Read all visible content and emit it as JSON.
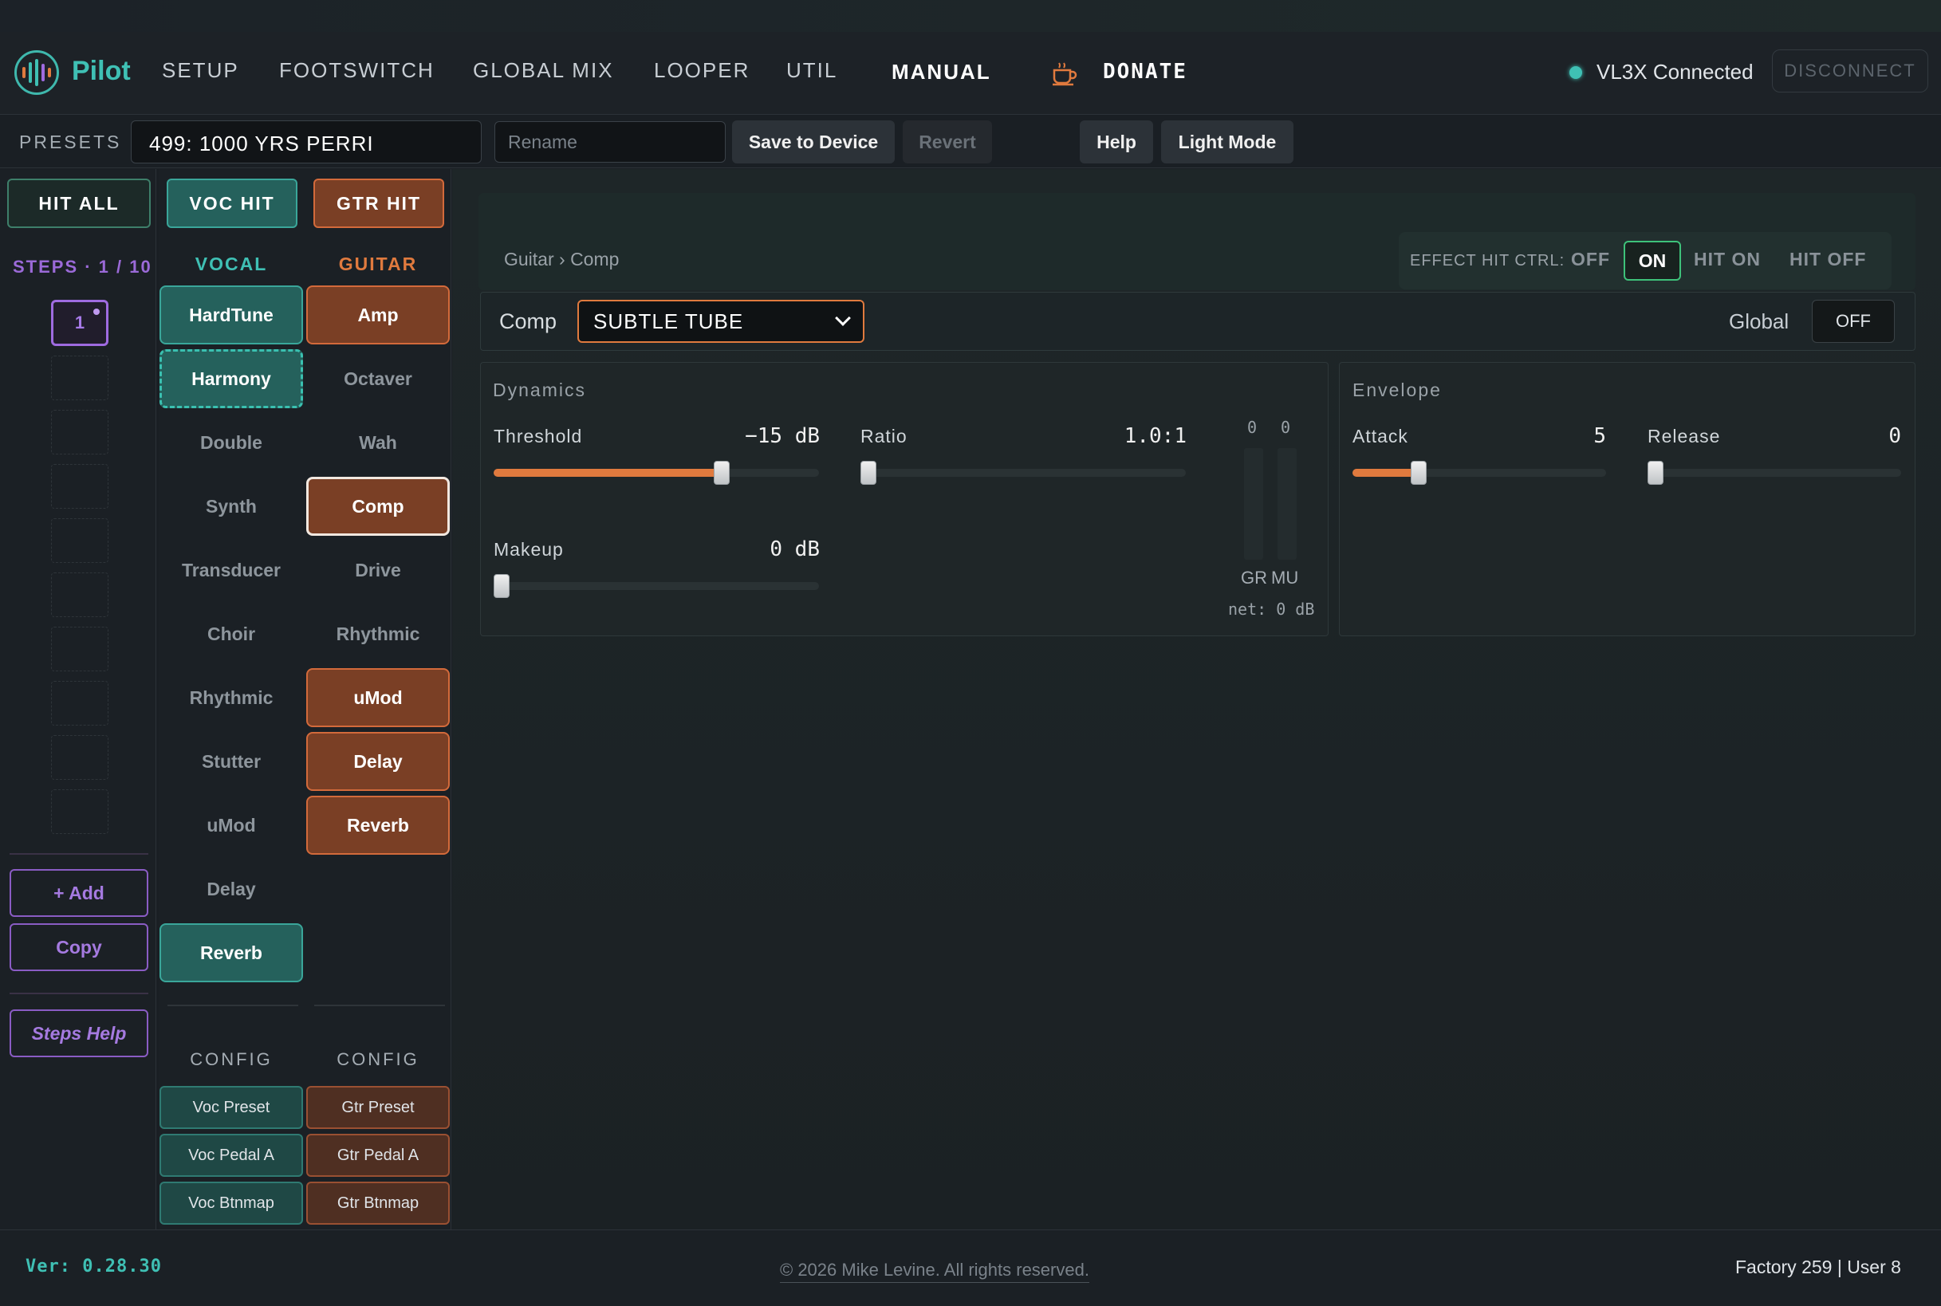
{
  "app": {
    "brand": "Pilot"
  },
  "nav": {
    "items": [
      "SETUP",
      "FOOTSWITCH",
      "GLOBAL MIX",
      "LOOPER",
      "UTIL",
      "MANUAL"
    ],
    "donate": "DONATE"
  },
  "connection": {
    "status": "VL3X Connected",
    "disconnect": "DISCONNECT",
    "status_color": "#3fc0b4"
  },
  "presets": {
    "label": "PRESETS",
    "current": "499: 1000 YRS PERRI",
    "rename_placeholder": "Rename",
    "save": "Save to Device",
    "revert": "Revert",
    "help": "Help",
    "light_mode": "Light Mode"
  },
  "hits": {
    "all": "HIT ALL",
    "voc": "VOC HIT",
    "gtr": "GTR HIT"
  },
  "steps": {
    "label": "STEPS · 1 / 10",
    "active": "1",
    "add": "+ Add",
    "copy": "Copy",
    "help": "Steps Help"
  },
  "vocal": {
    "title": "VOCAL",
    "effects": [
      {
        "label": "HardTune",
        "state": "on"
      },
      {
        "label": "Harmony",
        "state": "dashed"
      },
      {
        "label": "Double",
        "state": "off"
      },
      {
        "label": "Synth",
        "state": "off"
      },
      {
        "label": "Transducer",
        "state": "off"
      },
      {
        "label": "Choir",
        "state": "off"
      },
      {
        "label": "Rhythmic",
        "state": "off"
      },
      {
        "label": "Stutter",
        "state": "off"
      },
      {
        "label": "uMod",
        "state": "off"
      },
      {
        "label": "Delay",
        "state": "off"
      },
      {
        "label": "Reverb",
        "state": "on"
      }
    ],
    "config_label": "CONFIG",
    "config": [
      "Voc Preset",
      "Voc Pedal A",
      "Voc Btnmap"
    ]
  },
  "guitar": {
    "title": "GUITAR",
    "effects": [
      {
        "label": "Amp",
        "state": "on"
      },
      {
        "label": "Octaver",
        "state": "off"
      },
      {
        "label": "Wah",
        "state": "off"
      },
      {
        "label": "Comp",
        "state": "selected"
      },
      {
        "label": "Drive",
        "state": "off"
      },
      {
        "label": "Rhythmic",
        "state": "off"
      },
      {
        "label": "uMod",
        "state": "on"
      },
      {
        "label": "Delay",
        "state": "on"
      },
      {
        "label": "Reverb",
        "state": "on"
      }
    ],
    "config_label": "CONFIG",
    "config": [
      "Gtr Preset",
      "Gtr Pedal A",
      "Gtr Btnmap"
    ]
  },
  "editor": {
    "breadcrumb": "Guitar › Comp",
    "hit_ctrl": {
      "label": "EFFECT HIT CTRL:",
      "options": [
        "OFF",
        "ON",
        "HIT ON",
        "HIT OFF"
      ],
      "selected": "ON"
    },
    "effect_label": "Comp",
    "effect_type": "SUBTLE TUBE",
    "global_label": "Global",
    "global_value": "OFF",
    "dynamics": {
      "title": "Dynamics",
      "threshold": {
        "label": "Threshold",
        "value": "−15 dB",
        "level": 0.7
      },
      "ratio": {
        "label": "Ratio",
        "value": "1.0:1",
        "level": 0.0
      },
      "makeup": {
        "label": "Makeup",
        "value": "0 dB",
        "level": 0.0
      },
      "meters": {
        "gr_value": "0",
        "mu_value": "0",
        "gr_label": "GR",
        "mu_label": "MU",
        "net": "net: 0 dB"
      }
    },
    "envelope": {
      "title": "Envelope",
      "attack": {
        "label": "Attack",
        "value": "5",
        "level": 0.26
      },
      "release": {
        "label": "Release",
        "value": "0",
        "level": 0.0
      }
    }
  },
  "footer": {
    "version": "Ver: 0.28.30",
    "copyright": "© 2026 Mike Levine. All rights reserved.",
    "counts": "Factory 259 | User 8"
  },
  "colors": {
    "accent_teal": "#3fc0b4",
    "accent_orange": "#e07a3e",
    "accent_purple": "#9f6be0"
  }
}
